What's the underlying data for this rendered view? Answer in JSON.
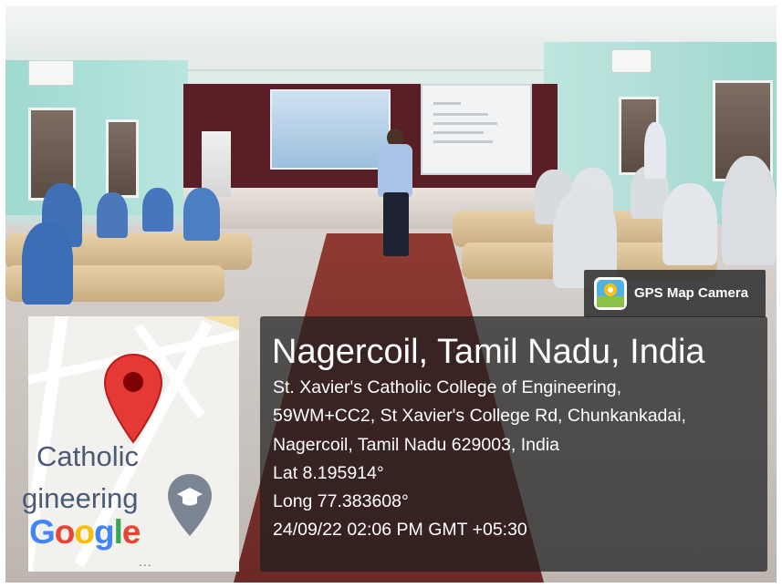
{
  "badge": {
    "icon": "gps-map-camera-icon",
    "label": "GPS Map Camera"
  },
  "location": {
    "title": "Nagercoil, Tamil Nadu, India",
    "address_line_1": "St. Xavier's Catholic College of Engineering,",
    "address_line_2": "59WM+CC2, St Xavier's College Rd, Chunkankadai,",
    "address_line_3": "Nagercoil, Tamil Nadu 629003, India",
    "latitude": "Lat 8.195914°",
    "longitude": "Long 77.383608°",
    "timestamp": "24/09/22 02:06 PM GMT +05:30"
  },
  "map_tile": {
    "label_top": "Catholic",
    "label_bottom": "gineering",
    "provider_logo": "Google",
    "dots": "...",
    "marker_icon": "red-location-pin-icon",
    "poi_icon": "graduation-cap-pin-icon"
  },
  "colors": {
    "pin_red": "#e53935",
    "google_blue": "#4285f4",
    "google_red": "#ea4335",
    "google_yellow": "#fbbc05",
    "google_green": "#34a853",
    "panel_bg": "#1e1e1e"
  }
}
